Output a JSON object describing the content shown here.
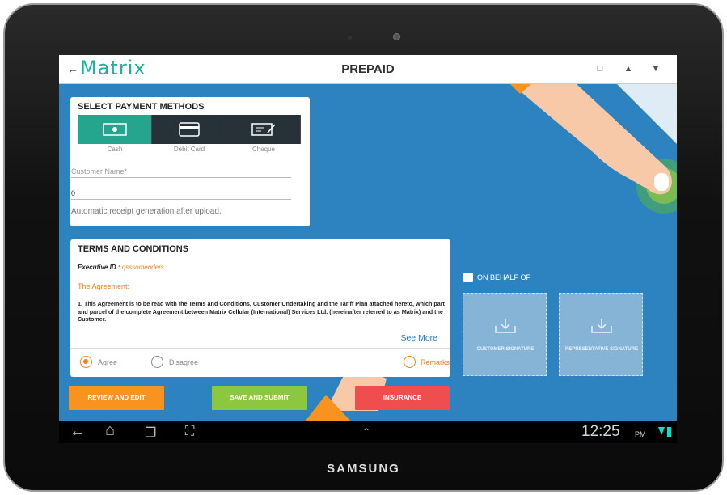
{
  "device": {
    "brand": "SAMSUNG"
  },
  "header": {
    "logo_text": "Matrix",
    "title": "PREPAID"
  },
  "payment": {
    "section_title": "SELECT PAYMENT METHODS",
    "methods": [
      {
        "label": "Cash",
        "icon": "cash-icon",
        "selected": true
      },
      {
        "label": "Debit Card",
        "icon": "debit-card-icon",
        "selected": false
      },
      {
        "label": "Cheque",
        "icon": "cheque-icon",
        "selected": false
      }
    ],
    "customer_name_placeholder": "Customer Name*",
    "amount_value": "0",
    "receipt_note": "Automatic receipt generation after upload."
  },
  "terms": {
    "section_title": "TERMS AND CONDITIONS",
    "exec_label": "Executive ID :",
    "exec_value": "qsssomenders",
    "agreement_heading": "The Agreement:",
    "agreement_text": "1.   This Agreement is to be read with the Terms and Conditions, Customer Undertaking and the Tariff Plan attached hereto, which part and parcel of the complete Agreement between Matrix Cellular (International) Services Ltd. (hereinafter referred to as Matrix) and the Customer.",
    "see_more": "See More",
    "agree_label": "Agree",
    "disagree_label": "Disagree",
    "agree_selected": true,
    "remarks_label": "Remarks"
  },
  "actions": {
    "review": "REVIEW AND EDIT",
    "submit": "SAVE AND SUBMIT",
    "insurance": "INSURANCE"
  },
  "signatures": {
    "behalf_label": "ON BEHALF OF",
    "customer": "CUSTOMER SIGNATURE",
    "representative": "REPRESENTATIVE SIGNATURE"
  },
  "statusbar": {
    "time": "12:25",
    "ampm": "PM"
  },
  "colors": {
    "screen_bg": "#2d82c0",
    "accent_teal": "#26a58e",
    "review_btn": "#f7931e",
    "submit_btn": "#8dc63f",
    "insurance_btn": "#f04e4e",
    "orange_text": "#f57f17"
  }
}
